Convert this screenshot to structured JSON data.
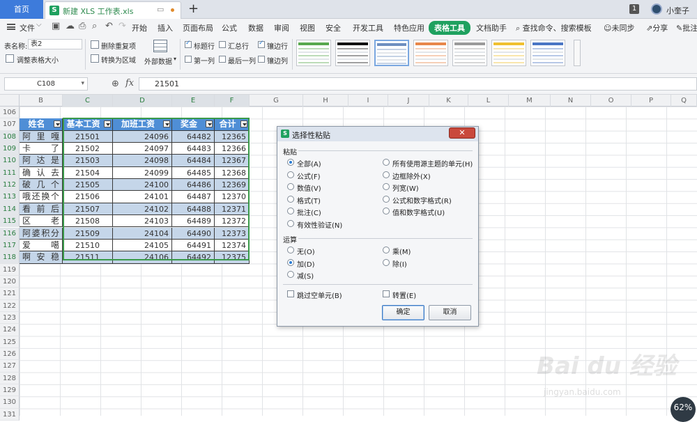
{
  "titlebar": {
    "home_tab": "首页",
    "doc_tab": "新建 XLS 工作表.xls",
    "page_badge": "1",
    "username": "小奎子"
  },
  "menubar": {
    "file": "文件",
    "items": [
      "开始",
      "插入",
      "页面布局",
      "公式",
      "数据",
      "审阅",
      "视图",
      "安全",
      "开发工具",
      "特色应用",
      "表格工具",
      "文档助手"
    ],
    "active_item": "表格工具",
    "search": "查找命令、搜索模板",
    "sync": "未同步",
    "share": "分享",
    "annotate": "批注"
  },
  "ribbon": {
    "table_name_label": "表名称:",
    "table_name_value": "表2",
    "resize_table": "调整表格大小",
    "remove_duplicates": "删除重复项",
    "convert_to_range": "转换为区域",
    "external_data": "外部数据",
    "options": [
      {
        "label": "标题行",
        "checked": true
      },
      {
        "label": "汇总行",
        "checked": false
      },
      {
        "label": "镶边行",
        "checked": true
      },
      {
        "label": "第一列",
        "checked": false
      },
      {
        "label": "最后一列",
        "checked": false
      },
      {
        "label": "镶边列",
        "checked": false
      }
    ],
    "style_colors": [
      "#58a84e",
      "#111111",
      "#6f8fbf",
      "#e8874a",
      "#9a9a9a",
      "#f0c030",
      "#4a76c4"
    ]
  },
  "formula": {
    "cell_ref": "C108",
    "fx": "fx",
    "value": "21501"
  },
  "grid": {
    "columns": [
      "B",
      "C",
      "D",
      "E",
      "F",
      "G",
      "H",
      "I",
      "J",
      "K",
      "L",
      "M",
      "N",
      "O",
      "P",
      "Q"
    ],
    "row_numbers": [
      "106",
      "107",
      "108",
      "109",
      "110",
      "111",
      "112",
      "113",
      "114",
      "115",
      "116",
      "117",
      "118",
      "119",
      "120",
      "121",
      "122",
      "123",
      "124",
      "125",
      "126",
      "127",
      "128",
      "129",
      "130",
      "131"
    ],
    "table": {
      "headers": [
        "姓名",
        "基本工资",
        "加班工资",
        "奖金",
        "合计"
      ],
      "rows": [
        [
          "阿里嘎",
          "21501",
          "24096",
          "64482",
          "12365"
        ],
        [
          "卡了",
          "21502",
          "24097",
          "64483",
          "12366"
        ],
        [
          "阿达是",
          "21503",
          "24098",
          "64484",
          "12367"
        ],
        [
          "确认去",
          "21504",
          "24099",
          "64485",
          "12368"
        ],
        [
          "破几个",
          "21505",
          "24100",
          "64486",
          "12369"
        ],
        [
          "哦还换个",
          "21506",
          "24101",
          "64487",
          "12370"
        ],
        [
          "看前后",
          "21507",
          "24102",
          "64488",
          "12371"
        ],
        [
          "区老",
          "21508",
          "24103",
          "64489",
          "12372"
        ],
        [
          "阿婆积分",
          "21509",
          "24104",
          "64490",
          "12373"
        ],
        [
          "爱噶",
          "21510",
          "24105",
          "64491",
          "12374"
        ],
        [
          "啊安稳",
          "21511",
          "24106",
          "64492",
          "12375"
        ]
      ]
    }
  },
  "dialog": {
    "title": "选择性粘贴",
    "paste_label": "粘贴",
    "paste_options_left": [
      "全部(A)",
      "公式(F)",
      "数值(V)",
      "格式(T)",
      "批注(C)",
      "有效性验证(N)"
    ],
    "paste_options_right": [
      "所有使用源主题的单元(H)",
      "边框除外(X)",
      "列宽(W)",
      "公式和数字格式(R)",
      "值和数字格式(U)"
    ],
    "selected_paste": "全部(A)",
    "operation_label": "运算",
    "operation_left": [
      "无(O)",
      "加(D)",
      "减(S)"
    ],
    "operation_right": [
      "乘(M)",
      "除(I)"
    ],
    "selected_operation": "加(D)",
    "skip_blanks": "跳过空单元(B)",
    "transpose": "转置(E)",
    "ok": "确定",
    "cancel": "取消"
  },
  "watermark": {
    "brand": "Bai du 经验",
    "url": "jingyan.baidu.com"
  },
  "zoom_badge": "62%"
}
